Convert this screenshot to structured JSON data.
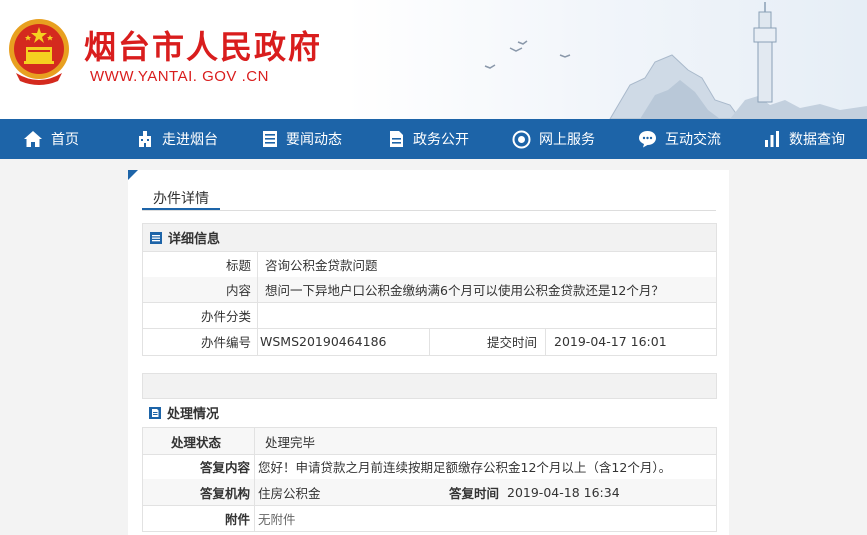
{
  "header": {
    "title": "烟台市人民政府",
    "url": "WWW.YANTAI. GOV .CN"
  },
  "nav": [
    {
      "label": "首页",
      "icon": "home-icon"
    },
    {
      "label": "走进烟台",
      "icon": "building-icon"
    },
    {
      "label": "要闻动态",
      "icon": "news-icon"
    },
    {
      "label": "政务公开",
      "icon": "document-icon"
    },
    {
      "label": "网上服务",
      "icon": "globe-icon"
    },
    {
      "label": "互动交流",
      "icon": "chat-icon"
    },
    {
      "label": "数据查询",
      "icon": "chart-icon"
    }
  ],
  "page": {
    "tab": "办件详情"
  },
  "detail": {
    "heading": "详细信息",
    "title_label": "标题",
    "title_value": "咨询公积金贷款问题",
    "content_label": "内容",
    "content_value": "想问一下异地户口公积金缴纳满6个月可以使用公积金贷款还是12个月？",
    "category_label": "办件分类",
    "category_value": "",
    "number_label": "办件编号",
    "number_value": "WSMS20190464186",
    "submit_label": "提交时间",
    "submit_value": "2019-04-17 16:01"
  },
  "handling": {
    "heading": "处理情况",
    "status_label": "处理状态",
    "status_value": "处理完毕",
    "reply_label": "答复内容",
    "reply_value": "您好！申请贷款之月前连续按期足额缴存公积金12个月以上（含12个月）。",
    "org_label": "答复机构",
    "org_value": "住房公积金",
    "reply_time_label": "答复时间",
    "reply_time_value": "2019-04-18 16:34",
    "attach_label": "附件",
    "attach_value": "无附件"
  },
  "colors": {
    "brand_red": "#d91d1d",
    "nav_blue": "#1d64a8"
  }
}
